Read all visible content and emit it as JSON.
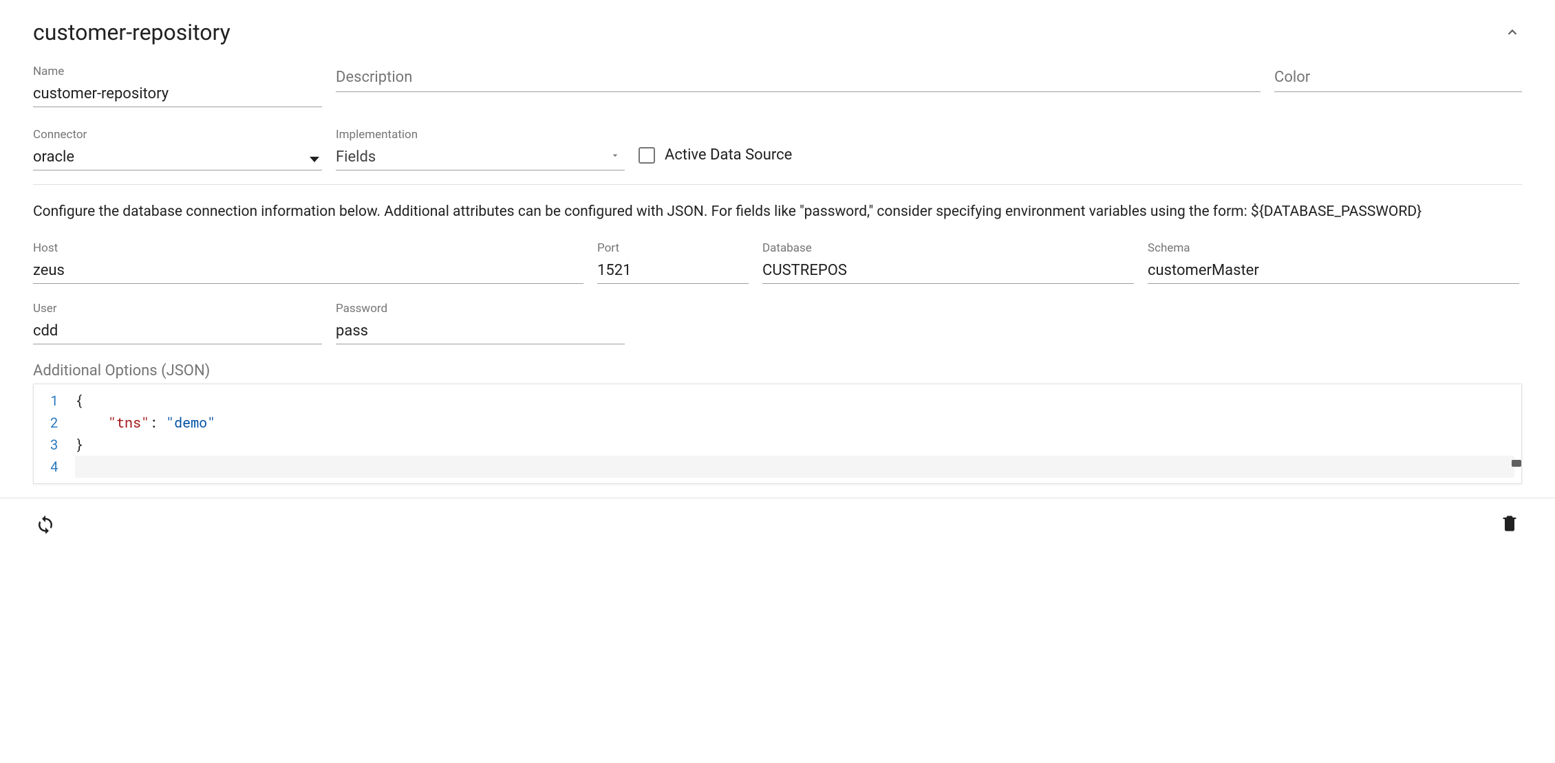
{
  "header": {
    "title": "customer-repository"
  },
  "fields": {
    "name": {
      "label": "Name",
      "value": "customer-repository"
    },
    "description": {
      "placeholder": "Description",
      "value": ""
    },
    "color": {
      "placeholder": "Color",
      "value": ""
    },
    "connector": {
      "label": "Connector",
      "value": "oracle"
    },
    "implementation": {
      "label": "Implementation",
      "value": "Fields"
    },
    "active": {
      "label": "Active Data Source",
      "checked": false
    },
    "host": {
      "label": "Host",
      "value": "zeus"
    },
    "port": {
      "label": "Port",
      "value": "1521"
    },
    "database": {
      "label": "Database",
      "value": "CUSTREPOS"
    },
    "schema": {
      "label": "Schema",
      "value": "customerMaster"
    },
    "user": {
      "label": "User",
      "value": "cdd"
    },
    "password": {
      "label": "Password",
      "value": "pass"
    }
  },
  "helpText": "Configure the database connection information below. Additional attributes can be configured with JSON. For fields like \"password,\" consider specifying environment variables using the form: ${DATABASE_PASSWORD}",
  "json": {
    "label": "Additional Options (JSON)",
    "lines": [
      "1",
      "2",
      "3",
      "4"
    ],
    "keyText": "\"tns\"",
    "valueText": "\"demo\"",
    "raw": "{\n    \"tns\": \"demo\"\n}\n"
  }
}
